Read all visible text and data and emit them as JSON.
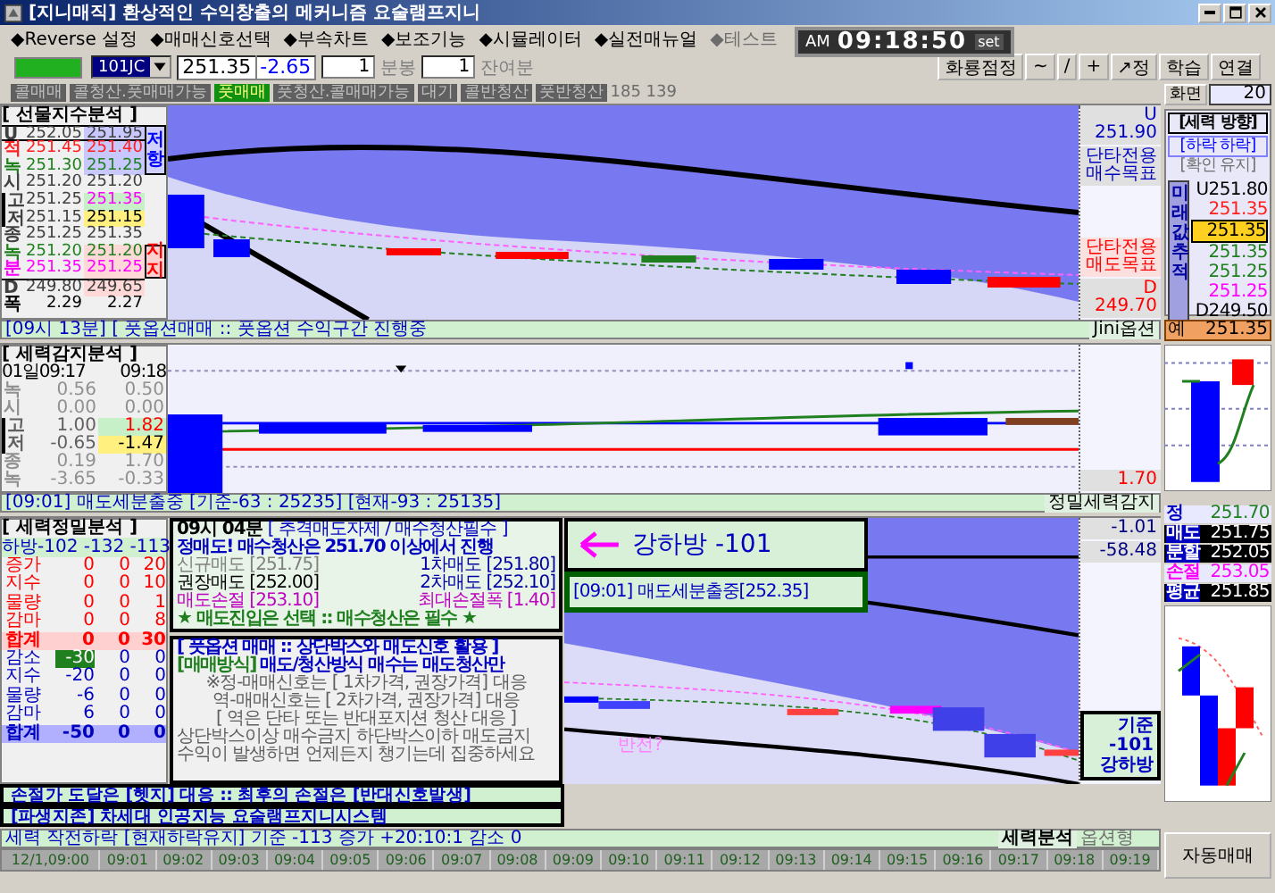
{
  "window": {
    "title": "[지니매직] 환상적인 수익창출의 메커니즘 요술램프지니"
  },
  "menu": [
    {
      "label": "◆Reverse 설정",
      "disabled": false
    },
    {
      "label": "◆매매신호선택",
      "disabled": false
    },
    {
      "label": "◆부속차트",
      "disabled": false
    },
    {
      "label": "◆보조기능",
      "disabled": false
    },
    {
      "label": "◆시뮬레이터",
      "disabled": false
    },
    {
      "label": "◆실전매뉴얼",
      "disabled": false
    },
    {
      "label": "◆테스트",
      "disabled": true
    }
  ],
  "clock": {
    "period": "AM",
    "time": "09:18:50",
    "button": "set"
  },
  "toolbar": {
    "symbol": "101JC",
    "price": "251.35",
    "change": "-2.65",
    "interval": "1",
    "interval_unit": "분봉",
    "remaining": "1",
    "remaining_unit": "잔여분",
    "buttons": [
      "화룡점정",
      "~",
      "/",
      "+",
      "↗정",
      "학습",
      "연결"
    ]
  },
  "signals": [
    {
      "label": "콜매매",
      "selected": false
    },
    {
      "label": "콜청산.풋매매가능",
      "selected": false
    },
    {
      "label": "풋매매",
      "selected": true
    },
    {
      "label": "풋청산.콜매매가능",
      "selected": false
    },
    {
      "label": "대기",
      "selected": false
    },
    {
      "label": "콜반청산",
      "selected": false
    },
    {
      "label": "풋반청산",
      "selected": false
    }
  ],
  "signal_counts": "185 139",
  "futures_panel": {
    "title": "[ 선물지수분석 ]",
    "tags": [
      {
        "kind": "resist",
        "text": "저항"
      },
      {
        "kind": "support",
        "text": "지지"
      }
    ],
    "rows": [
      {
        "label": "U",
        "kind": "upper",
        "color": "#404040",
        "values": [
          "252.05",
          "251.95"
        ]
      },
      {
        "label": "적",
        "kind": "resist",
        "color": "#ff2020",
        "values": [
          "251.45",
          "251.40"
        ]
      },
      {
        "label": "녹",
        "kind": "resist",
        "color": "#208020",
        "values": [
          "251.30",
          "251.25"
        ]
      },
      {
        "label": "시",
        "kind": "plain",
        "color": "#404040",
        "values": [
          "251.20",
          "251.20"
        ]
      },
      {
        "label": "고",
        "kind": "high",
        "color": "#404040",
        "values": [
          "251.25",
          "251.35"
        ]
      },
      {
        "label": "저",
        "kind": "low",
        "color": "#404040",
        "values": [
          "251.15",
          "251.15"
        ]
      },
      {
        "label": "종",
        "kind": "plain",
        "color": "#404040",
        "values": [
          "251.25",
          "251.35"
        ]
      },
      {
        "label": "녹",
        "kind": "support",
        "color": "#208020",
        "values": [
          "251.20",
          "251.20"
        ]
      },
      {
        "label": "분",
        "kind": "support",
        "color": "#ff00ff",
        "values": [
          "251.35",
          "251.25"
        ]
      },
      {
        "label": "D",
        "kind": "lower",
        "color": "#404040",
        "values": [
          "249.80",
          "249.65"
        ]
      },
      {
        "label": "폭",
        "kind": "width",
        "color": "#000000",
        "values": [
          "2.29",
          "2.27"
        ]
      }
    ]
  },
  "top_status": {
    "text": "[09시 13분] [ 풋옵션매매 :: 풋옵션 수익구간 진행중",
    "right": "Jini옵션"
  },
  "top_scale": {
    "upper": "U 251.90",
    "buy_target": "단타전용 매수목표",
    "sell_target": "단타전용 매도목표",
    "lower": "D 249.70"
  },
  "force_panel": {
    "title": "[ 세력감지분석 ]",
    "header": [
      "01일09:17",
      "09:18"
    ],
    "rows": [
      {
        "label": "녹",
        "kind": "faint",
        "values": [
          "0.56",
          "0.50"
        ]
      },
      {
        "label": "시",
        "kind": "faint",
        "values": [
          "0.00",
          "0.00"
        ]
      },
      {
        "label": "고",
        "kind": "high",
        "values": [
          "1.00",
          "1.82"
        ]
      },
      {
        "label": "저",
        "kind": "low",
        "values": [
          "-0.65",
          "-1.47"
        ]
      },
      {
        "label": "종",
        "kind": "faint",
        "values": [
          "0.19",
          "1.70"
        ]
      },
      {
        "label": "녹",
        "kind": "faint",
        "values": [
          "-3.65",
          "-0.33"
        ]
      }
    ]
  },
  "mid_scale": "1.70",
  "mid_status": {
    "text": "[09:01] 매도세분출중 [기준-63 : 25235] [현재-93 : 25135]",
    "right": "정밀세력감지"
  },
  "precision_panel": {
    "title": "[ 세력정밀분석 ]",
    "summary": "하방-102 -132 -113",
    "rows": [
      {
        "label": "증가",
        "kind": "up",
        "active": false,
        "values": [
          "0",
          "0",
          "20"
        ]
      },
      {
        "label": "지수",
        "kind": "up",
        "active": false,
        "values": [
          "0",
          "0",
          "10"
        ]
      },
      {
        "label": "물량",
        "kind": "up",
        "active": false,
        "values": [
          "0",
          "0",
          "1"
        ]
      },
      {
        "label": "감마",
        "kind": "up",
        "active": false,
        "values": [
          "0",
          "0",
          "8"
        ]
      },
      {
        "label": "합계",
        "kind": "up_total",
        "active": false,
        "values": [
          "0",
          "0",
          "30"
        ]
      },
      {
        "label": "감소",
        "kind": "down",
        "active": true,
        "values": [
          "-30",
          "0",
          "0"
        ]
      },
      {
        "label": "지수",
        "kind": "down",
        "active": false,
        "values": [
          "-20",
          "0",
          "0"
        ]
      },
      {
        "label": "물량",
        "kind": "down",
        "active": false,
        "values": [
          "-6",
          "0",
          "0"
        ]
      },
      {
        "label": "감마",
        "kind": "down",
        "active": false,
        "values": [
          "6",
          "0",
          "0"
        ]
      },
      {
        "label": "합계",
        "kind": "down_total",
        "active": false,
        "values": [
          "-50",
          "0",
          "0"
        ]
      }
    ]
  },
  "strategy": {
    "time": "09시 04분",
    "note": "[ 추격매도자제 / 매수청산필수 ]",
    "headline": "정매도! 매수청산은 251.70 이상에서 진행",
    "levels": [
      {
        "label": "신규매도 [251.75]",
        "kind": "entry"
      },
      {
        "label": "1차매도 [251.80]",
        "kind": "first"
      },
      {
        "label": "권장매도 [252.00]",
        "kind": "recommended"
      },
      {
        "label": "2차매도 [252.10]",
        "kind": "first"
      },
      {
        "label": "매도손절 [253.10]",
        "kind": "stop"
      },
      {
        "label": "최대손절폭 [1.40]",
        "kind": "stop"
      }
    ],
    "footer": "★ 매도진입은 선택 :: 매수청산은 필수 ★"
  },
  "guide": {
    "title": "[ 풋옵션 매매 :: 상단박스와 매도신호 활용 ]",
    "method_tag": "[매매방식]",
    "method": "매도/청산방식 매수는 매도청산만",
    "notes": [
      "※정-매매신호는 [ 1차가격, 권장가격] 대응",
      "역-매매신호는 [ 2차가격, 권장가격] 대응",
      "[ 역은 단타 또는 반대포지션 청산 대응 ]",
      "상단박스이상 매수금지  하단박스이하 매도금지",
      "수익이 발생하면 언제든지 챙기는데 집중하세요"
    ]
  },
  "banners": [
    "손절가 도달은 [헷지] 대응 :: 최후의 손절은 [반대신호발생]",
    "[파생지존] 차세대 인공지능 요술램프지니시스템"
  ],
  "callout": {
    "text": "강하방 -101",
    "signal": "[09:01] 매도세분출중[252.35]"
  },
  "chart_note": "반전?",
  "low_scale": [
    "-1.01",
    "-58.48"
  ],
  "base_box": [
    "기준",
    "-101",
    "강하방"
  ],
  "bottom_status": {
    "text": "세력 작전하락 [현재하락유지] 기준 -113 증가 +20:10:1  감소 0",
    "right": "세력분석",
    "right_muted": "옵션형"
  },
  "time_axis": [
    "12/1,09:00",
    "09:01",
    "09:02",
    "09:03",
    "09:04",
    "09:05",
    "09:06",
    "09:07",
    "09:08",
    "09:09",
    "09:10",
    "09:11",
    "09:12",
    "09:13",
    "09:14",
    "09:15",
    "09:16",
    "09:17",
    "09:18",
    "09:19"
  ],
  "sidebar": {
    "screen_label": "화면",
    "screen_value": "20",
    "direction_title": "[세력 방향]",
    "direction": "[하락 하락]",
    "direction_muted": "[확인 유지]",
    "future_label": "미래값추적",
    "future": [
      {
        "value": "U251.80",
        "color": "#000000",
        "highlighted": false
      },
      {
        "value": "251.35",
        "color": "#ff2020",
        "highlighted": false
      },
      {
        "value": "251.35",
        "color": "#000000",
        "highlighted": true
      },
      {
        "value": "251.35",
        "color": "#208020",
        "highlighted": false
      },
      {
        "value": "251.25",
        "color": "#208020",
        "highlighted": false
      },
      {
        "value": "251.25",
        "color": "#ff00ff",
        "highlighted": false
      },
      {
        "value": "D249.50",
        "color": "#000000",
        "highlighted": false
      }
    ],
    "current": {
      "label": "예",
      "value": "251.35"
    },
    "orders": [
      {
        "label": "정",
        "value": "251.70",
        "kind": "plain"
      },
      {
        "label": "매도",
        "value": "251.75",
        "kind": "boxed"
      },
      {
        "label": "분할",
        "value": "252.05",
        "kind": "boxed"
      },
      {
        "label": "손절",
        "value": "253.05",
        "kind": "stop"
      },
      {
        "label": "평균",
        "value": "251.85",
        "kind": "boxed"
      }
    ],
    "auto_button": "자동매매"
  }
}
